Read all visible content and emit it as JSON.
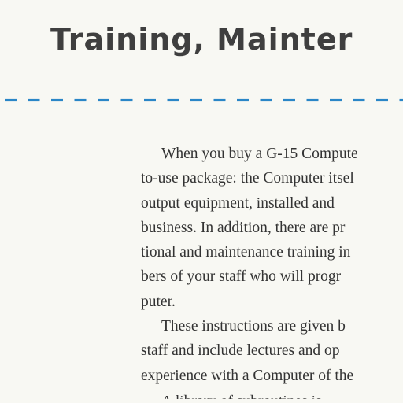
{
  "heading": "Training, Mainter",
  "colors": {
    "background": "#f8f8f3",
    "heading": "#3f3f3f",
    "rule": "#2a86c7",
    "text": "#333333"
  },
  "body": {
    "lines": [
      "When you buy a G-15 Compute",
      "to-use package: the Computer itsel",
      "output equipment, installed and",
      "business. In addition, there are pr",
      "tional and maintenance training in",
      "bers of your staff who will progr",
      "puter.",
      "These instructions are given b",
      "staff and include lectures and op",
      "experience with a Computer of the",
      "A library of subroutines is"
    ]
  }
}
